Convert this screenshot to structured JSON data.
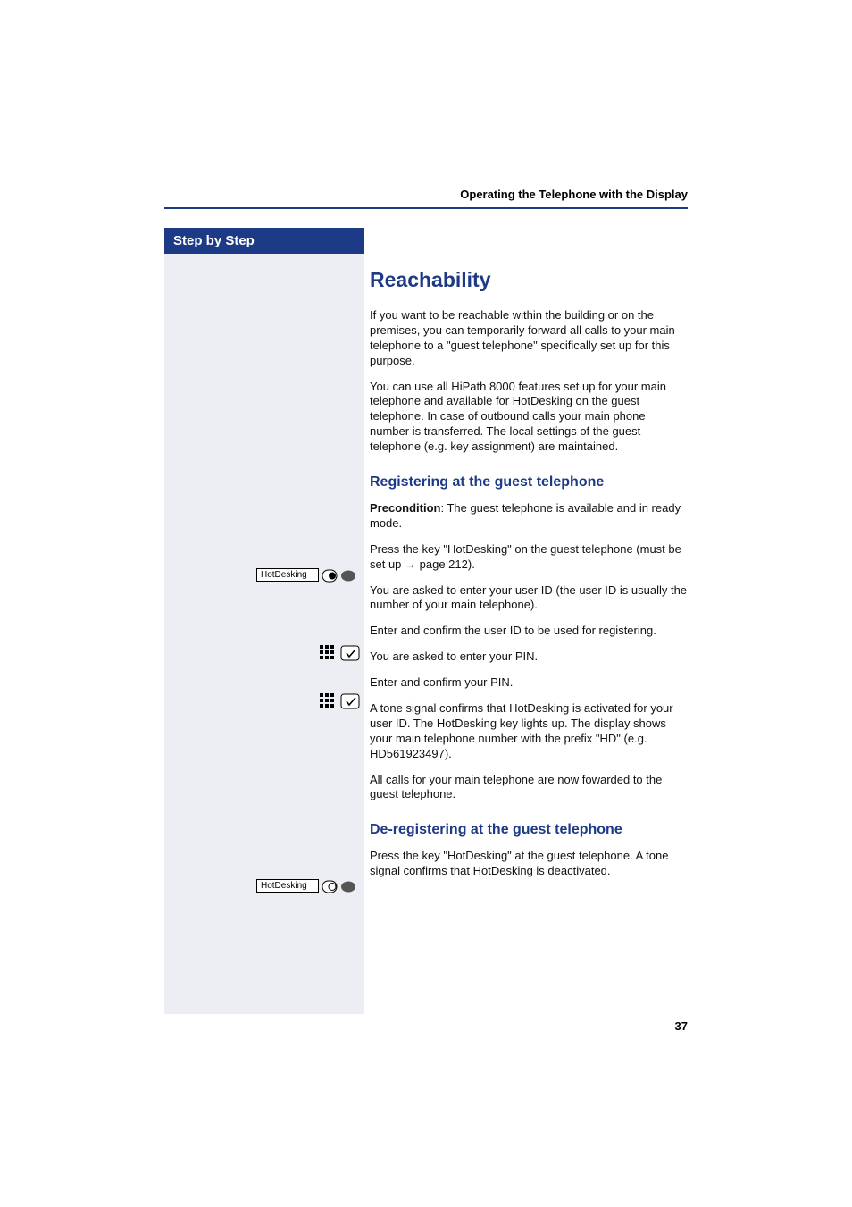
{
  "header": {
    "running_head": "Operating the Telephone with the Display"
  },
  "sidebar": {
    "title": "Step by Step"
  },
  "section": {
    "title": "Reachability",
    "intro1": "If you want to be reachable within the building or on the premises, you can temporarily forward all calls to your main telephone to a \"guest telephone\" specifically set up for this purpose.",
    "intro2": "You can use all HiPath 8000 features set up for your main telephone and available for HotDesking on the guest telephone. In case of outbound calls your main phone number is transferred. The local settings of the guest telephone (e.g. key assignment) are maintained.",
    "register": {
      "title": "Registering at the guest telephone",
      "precond_label": "Precondition",
      "precond_text": ": The guest telephone is available and in ready mode.",
      "press_key_prefix": "Press the key \"HotDesking\" on the guest telephone (must be set up ",
      "press_key_arrow": "→",
      "press_key_suffix": " page 212).",
      "ask_user": "You are asked to enter your user ID (the user ID is usually the number of your main telephone).",
      "enter_user": "Enter and confirm the user ID to be used for registering.",
      "ask_pin": "You are asked to enter your PIN.",
      "enter_pin": "Enter and confirm your PIN.",
      "tone": "A tone signal confirms that HotDesking is activated for your user ID. The HotDesking key lights up. The display shows your main telephone number with the prefix \"HD\" (e.g. HD561923497).",
      "all_calls": "All calls for your main telephone are now fowarded to the guest telephone."
    },
    "deregister": {
      "title": "De-registering at the guest telephone",
      "press_key": "Press the key \"HotDesking\" at the guest telephone. A tone signal confirms that HotDesking is deactivated."
    }
  },
  "labels": {
    "hotdesking1": "HotDesking",
    "hotdesking2": "HotDesking"
  },
  "page_number": "37"
}
